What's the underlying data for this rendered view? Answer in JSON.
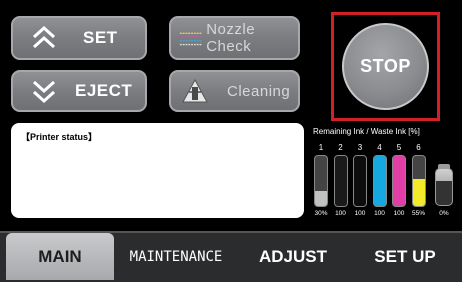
{
  "buttons": {
    "set_label": "SET",
    "eject_label": "EJECT",
    "nozzle_check_label": "Nozzle Check",
    "cleaning_label": "Cleaning",
    "stop_label": "STOP"
  },
  "status": {
    "label": "【Printer status】"
  },
  "ink": {
    "title": "Remaining Ink / Waste Ink [%]",
    "cartridges": [
      {
        "number": "1",
        "percent_label": "30%",
        "level": 0.3,
        "color": "#bfc1c3"
      },
      {
        "number": "2",
        "percent_label": "100",
        "level": 1.0,
        "color": "#1a1a1a"
      },
      {
        "number": "3",
        "percent_label": "100",
        "level": 1.0,
        "color": "#0d0d0d"
      },
      {
        "number": "4",
        "percent_label": "100",
        "level": 1.0,
        "color": "#16a8e0"
      },
      {
        "number": "5",
        "percent_label": "100",
        "level": 1.0,
        "color": "#e23fa6"
      },
      {
        "number": "6",
        "percent_label": "55%",
        "level": 0.55,
        "color": "#f3ea2a"
      }
    ],
    "waste": {
      "percent_label": "0%",
      "level": 0.0
    }
  },
  "tabs": {
    "main": "MAIN",
    "maintenance": "MAINTENANCE",
    "adjust": "ADJUST",
    "setup": "SET UP"
  },
  "colors": {
    "stop_frame": "#d32027",
    "button_gray": "#7b7d80"
  }
}
